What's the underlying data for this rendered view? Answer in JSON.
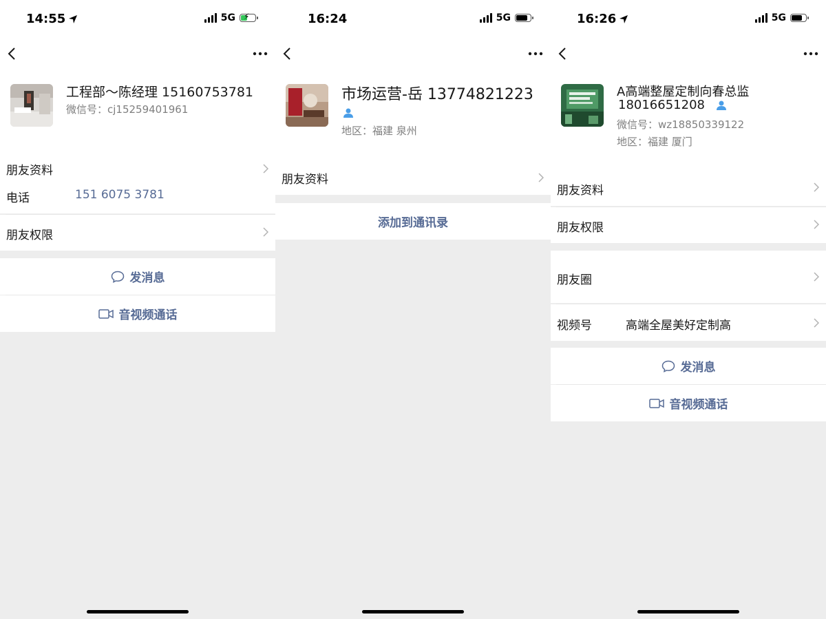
{
  "panel1": {
    "time": "14:55",
    "network": "5G",
    "contact": {
      "name": "工程部～陈经理 15160753781",
      "wechat_id": "微信号：cj15259401961"
    },
    "friend_profile": "朋友资料",
    "phone_label": "电话",
    "phone_value": "151 6075 3781",
    "friend_permission": "朋友权限",
    "send_message": "发消息",
    "video_call": "音视频通话"
  },
  "panel2": {
    "time": "16:24",
    "network": "5G",
    "contact": {
      "name": "市场运营-岳 13774821223",
      "region": "地区：福建 泉州"
    },
    "friend_profile": "朋友资料",
    "add_to_contacts": "添加到通讯录"
  },
  "panel3": {
    "time": "16:26",
    "network": "5G",
    "contact": {
      "name_line1": "A高端整屋定制向春总监",
      "name_line2": "18016651208",
      "wechat_id": "微信号：wz18850339122",
      "region": "地区：福建 厦门"
    },
    "friend_profile": "朋友资料",
    "friend_permission": "朋友权限",
    "moments": "朋友圈",
    "channels_label": "视频号",
    "channels_value": "高端全屋美好定制高",
    "send_message": "发消息",
    "video_call": "音视频通话"
  },
  "colors": {
    "link": "#576b95",
    "secondary_text": "#7f7f7f",
    "background": "#ededed",
    "accent_person_icon": "#4a9ee8",
    "charging": "#34c759"
  },
  "icons": [
    "location-arrow-icon",
    "signal-icon",
    "battery-icon",
    "back-chevron-icon",
    "more-icon",
    "chevron-right-icon",
    "chat-bubble-icon",
    "video-camera-icon",
    "person-icon"
  ]
}
